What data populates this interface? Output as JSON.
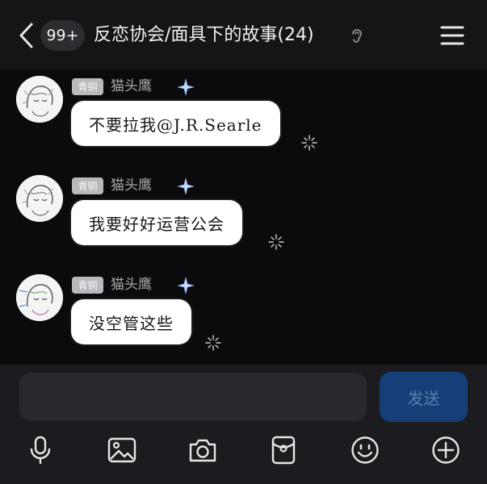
{
  "header": {
    "unread_badge": "99+",
    "title": "反恋协会/面具下的故事(24)"
  },
  "messages": [
    {
      "level": "青铜",
      "name": "猫头鹰",
      "text": "不要拉我@J.R.Searle"
    },
    {
      "level": "青铜",
      "name": "猫头鹰",
      "text": "我要好好运营公会"
    },
    {
      "level": "青铜",
      "name": "猫头鹰",
      "text": "没空管这些"
    }
  ],
  "input": {
    "placeholder": "",
    "send_label": "发送"
  },
  "toolbar": {
    "icons": [
      "microphone-icon",
      "image-icon",
      "camera-icon",
      "red-packet-icon",
      "emoji-icon",
      "plus-icon"
    ]
  },
  "colors": {
    "background": "#0b0a0c",
    "header": "#151417",
    "bubble": "#ffffff",
    "send_button": "#163f78",
    "send_text": "#5c7eaa",
    "level_badge": "#b9b9bd"
  }
}
